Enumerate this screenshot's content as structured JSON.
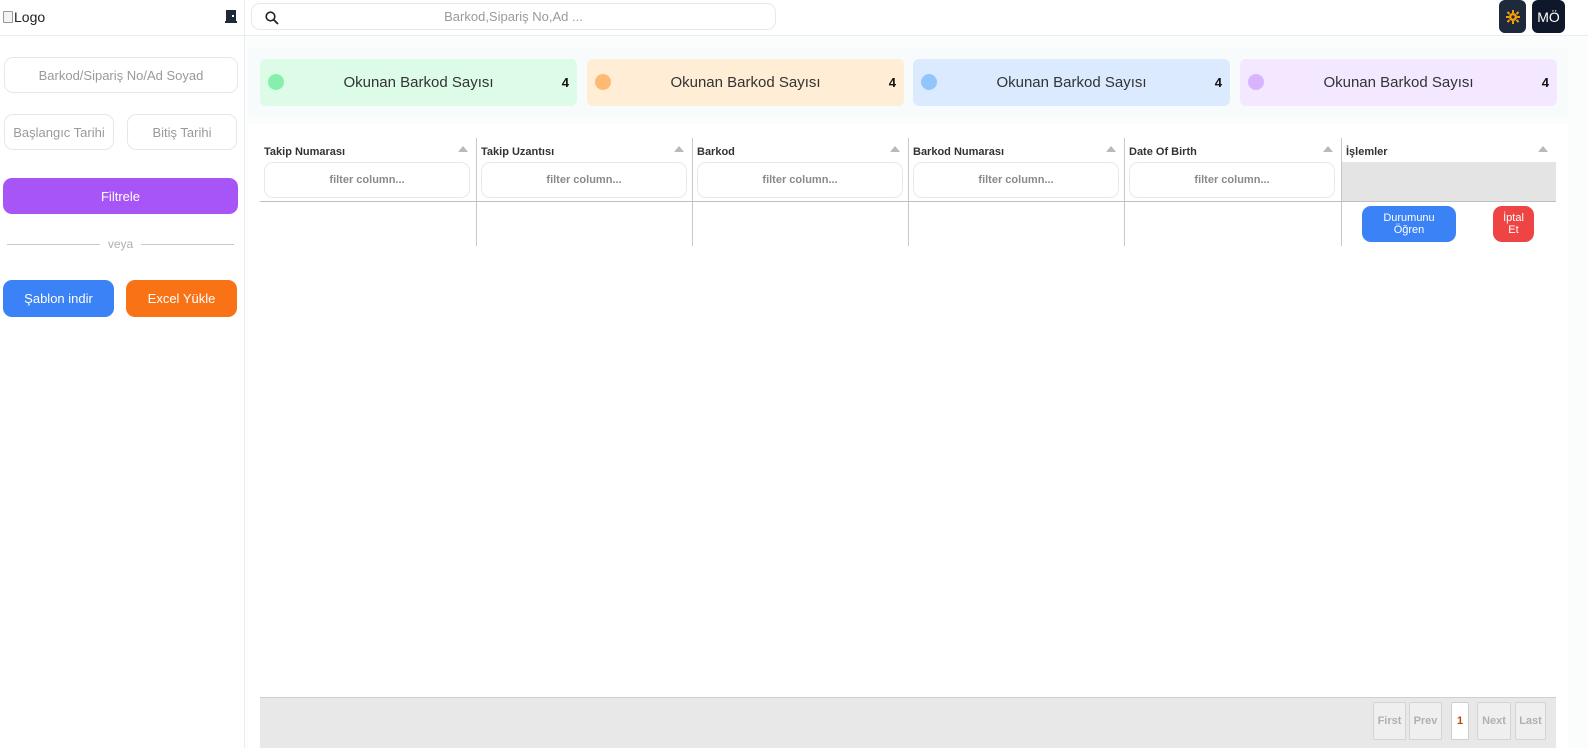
{
  "sidebar": {
    "logo_alt": "Logo",
    "search_placeholder": "Barkod/Sipariş No/Ad Soyad",
    "start_date_placeholder": "Başlangıc Tarihi",
    "end_date_placeholder": "Bitiş Tarihi",
    "filter_label": "Filtrele",
    "or_label": "veya",
    "template_label": "Şablon indir",
    "excel_label": "Excel Yükle"
  },
  "topbar": {
    "search_placeholder": "Barkod,Sipariş No,Ad ...",
    "avatar_initials": "MÖ"
  },
  "cards": [
    {
      "label": "Okunan Barkod Sayısı",
      "count": "4",
      "bg": "#dcfce7",
      "dot": "#86efac"
    },
    {
      "label": "Okunan Barkod Sayısı",
      "count": "4",
      "bg": "#ffedd5",
      "dot": "#fdba74"
    },
    {
      "label": "Okunan Barkod Sayısı",
      "count": "4",
      "bg": "#dbeafe",
      "dot": "#93c5fd"
    },
    {
      "label": "Okunan Barkod Sayısı",
      "count": "4",
      "bg": "#f3e8ff",
      "dot": "#d8b4fe"
    }
  ],
  "table": {
    "columns": [
      "Takip Numarası",
      "Takip Uzantısı",
      "Barkod",
      "Barkod Numarası",
      "Date Of Birth",
      "İşlemler"
    ],
    "filter_placeholder": "filter column...",
    "row_actions": {
      "status_label": "Durumunu Öğren",
      "cancel_label": "İptal Et"
    }
  },
  "pagination": {
    "first": "First",
    "prev": "Prev",
    "current": "1",
    "next": "Next",
    "last": "Last"
  }
}
